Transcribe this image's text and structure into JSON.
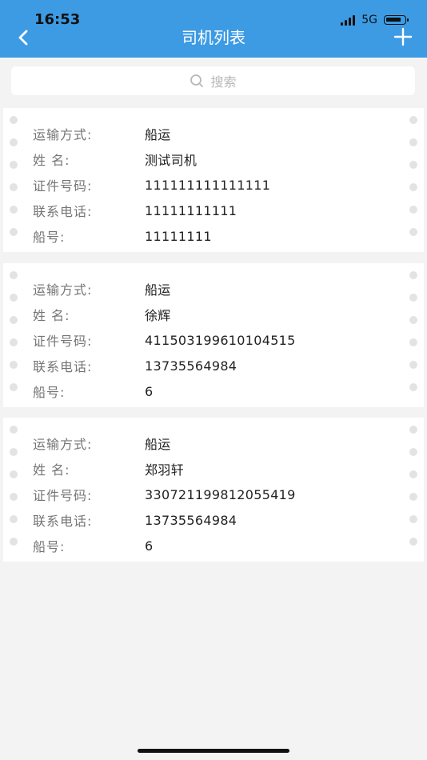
{
  "status_bar": {
    "time": "16:53",
    "network": "5G"
  },
  "header": {
    "title": "司机列表"
  },
  "search": {
    "placeholder": "搜索"
  },
  "cards": [
    {
      "rows": [
        {
          "label": "运输方式:",
          "value": "船运"
        },
        {
          "label": "姓 名:",
          "value": "测试司机"
        },
        {
          "label": "证件号码:",
          "value": "111111111111111"
        },
        {
          "label": "联系电话:",
          "value": "11111111111"
        },
        {
          "label": "船号:",
          "value": "11111111"
        }
      ]
    },
    {
      "rows": [
        {
          "label": "运输方式:",
          "value": "船运"
        },
        {
          "label": "姓 名:",
          "value": "徐辉"
        },
        {
          "label": "证件号码:",
          "value": "411503199610104515"
        },
        {
          "label": "联系电话:",
          "value": "13735564984"
        },
        {
          "label": "船号:",
          "value": "6"
        }
      ]
    },
    {
      "rows": [
        {
          "label": "运输方式:",
          "value": "船运"
        },
        {
          "label": "姓 名:",
          "value": "郑羽轩"
        },
        {
          "label": "证件号码:",
          "value": "330721199812055419"
        },
        {
          "label": "联系电话:",
          "value": "13735564984"
        },
        {
          "label": "船号:",
          "value": "6"
        }
      ]
    }
  ],
  "colors": {
    "header": "#3d9be4",
    "background": "#f3f3f3",
    "card": "#ffffff"
  },
  "icons": {
    "back": "back-arrow-icon",
    "add": "plus-icon",
    "search": "search-icon"
  }
}
